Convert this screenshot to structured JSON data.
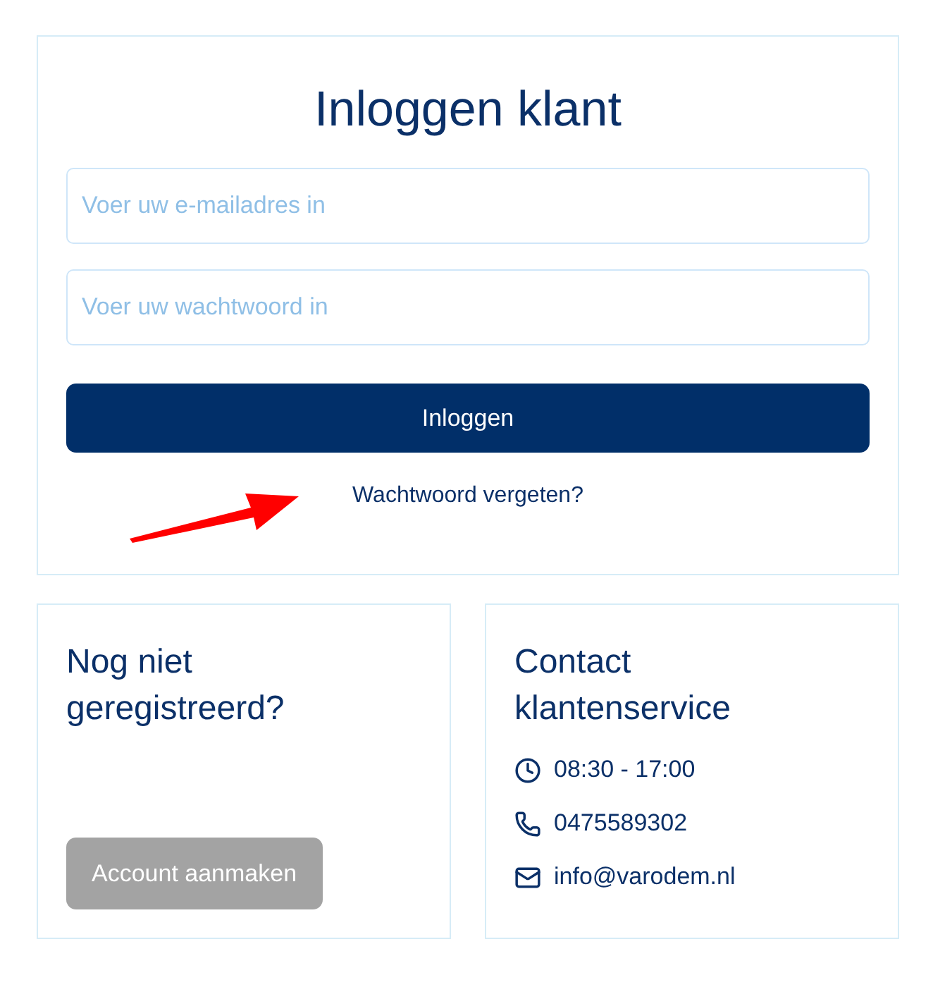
{
  "login": {
    "title": "Inloggen klant",
    "email": {
      "placeholder": "Voer uw e-mailadres in"
    },
    "password": {
      "placeholder": "Voer uw wachtwoord in"
    },
    "submit": "Inloggen",
    "forgot_link": "Wachtwoord vergeten?"
  },
  "register": {
    "title": "Nog niet geregistreerd?",
    "button": "Account aanmaken",
    "button_disabled": true
  },
  "contact": {
    "title": "Contact klantenservice",
    "items": [
      {
        "kind": "clock",
        "text": "08:30 - 17:00"
      },
      {
        "kind": "phone",
        "text": "0475589302"
      },
      {
        "kind": "mail",
        "text": "info@varodem.nl"
      }
    ]
  }
}
